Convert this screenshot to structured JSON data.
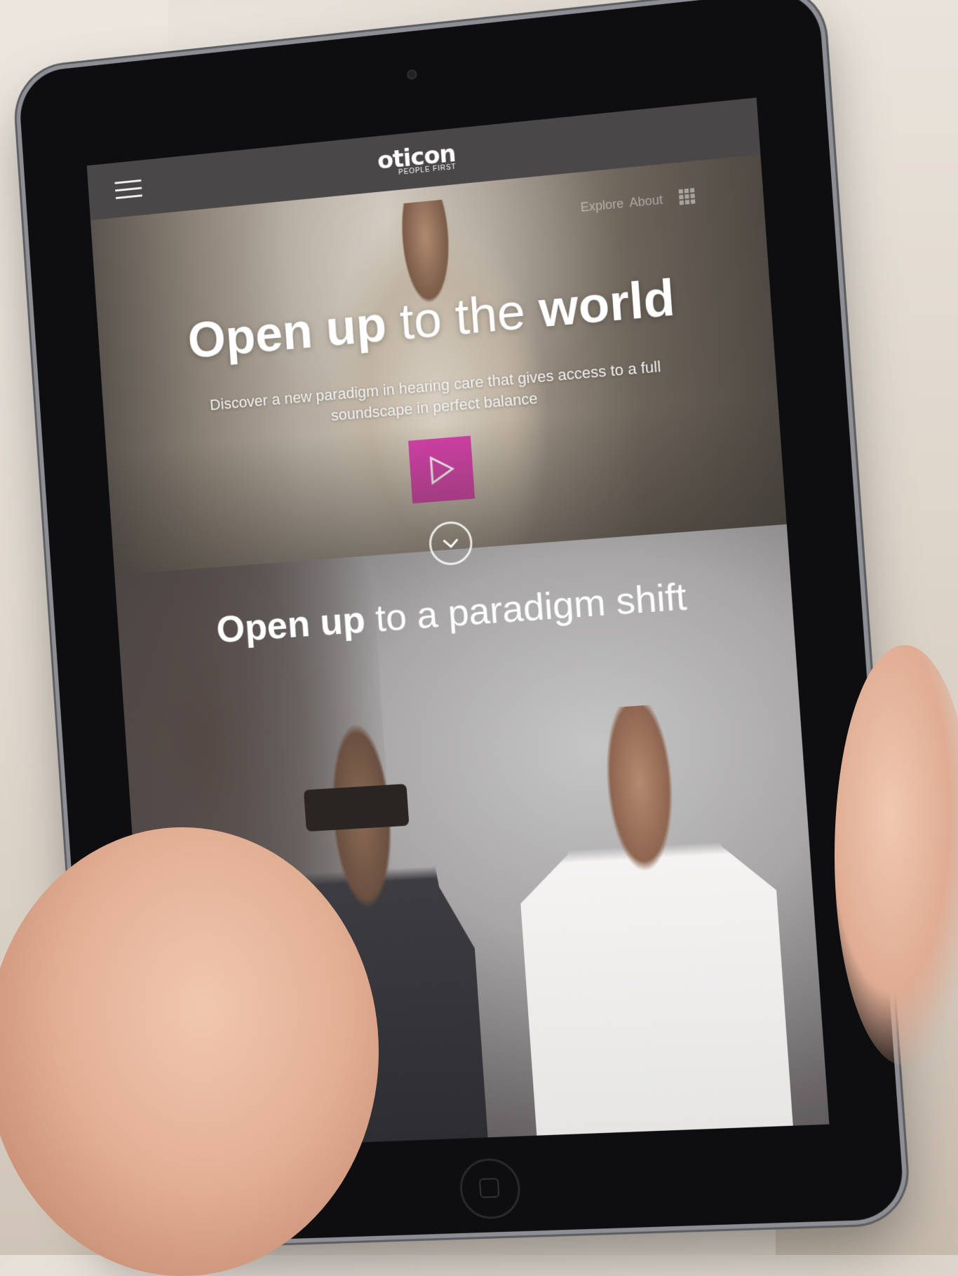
{
  "brand": {
    "logo_main": "oticon",
    "logo_sub": "PEOPLE FIRST",
    "accent_color": "#d43fa8"
  },
  "navbar": {
    "menu_icon": "hamburger-menu-icon"
  },
  "hero": {
    "sublinks": [
      "Explore",
      "About"
    ],
    "grid_icon": "grid-menu-icon",
    "title_bold_1": "Open up",
    "title_light": "to the",
    "title_bold_2": "world",
    "description": "Discover a new paradigm in hearing care that gives access to a full soundscape in perfect balance",
    "play_icon": "play-icon",
    "scroll_icon": "chevron-down-icon"
  },
  "section2": {
    "title_bold": "Open up",
    "title_light": "to a paradigm shift"
  }
}
